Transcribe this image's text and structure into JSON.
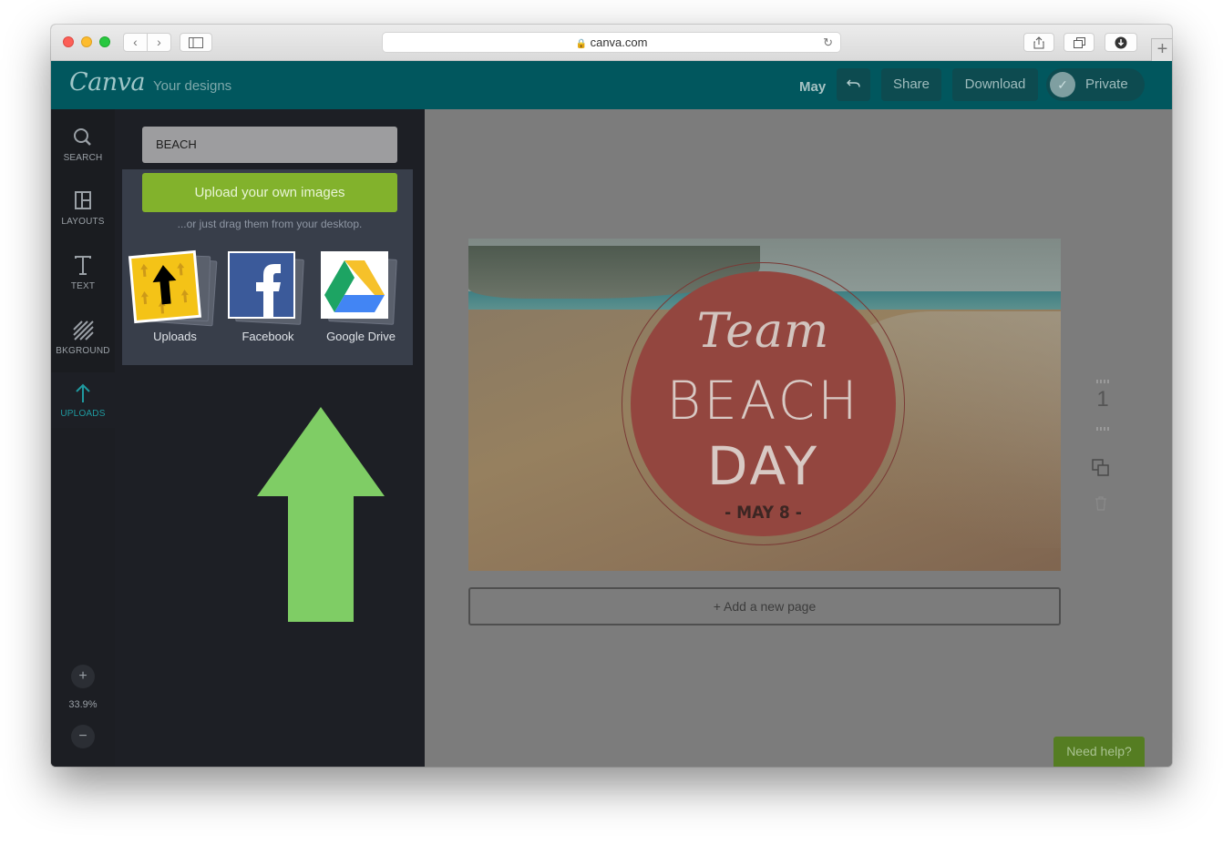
{
  "browser": {
    "url": "canva.com",
    "new_tab_label": "+"
  },
  "header": {
    "logo": "Canva",
    "your_designs": "Your designs",
    "doc_title": "May",
    "share_label": "Share",
    "download_label": "Download",
    "private_label": "Private"
  },
  "rail": {
    "items": [
      {
        "label": "SEARCH",
        "icon": "search-icon"
      },
      {
        "label": "LAYOUTS",
        "icon": "layouts-icon"
      },
      {
        "label": "TEXT",
        "icon": "text-icon"
      },
      {
        "label": "BKGROUND",
        "icon": "background-icon"
      },
      {
        "label": "UPLOADS",
        "icon": "upload-icon"
      }
    ],
    "zoom_in": "+",
    "zoom_level": "33.9%",
    "zoom_out": "−"
  },
  "panel": {
    "search_value": "BEACH",
    "upload_button": "Upload your own images",
    "drag_hint": "...or just drag them from your desktop.",
    "sources": [
      {
        "label": "Uploads",
        "icon": "uploads-folder-icon"
      },
      {
        "label": "Facebook",
        "icon": "facebook-icon"
      },
      {
        "label": "Google Drive",
        "icon": "google-drive-icon"
      }
    ]
  },
  "design": {
    "line1": "Team",
    "line2": "BEACH",
    "line3": "DAY",
    "line4": "- MAY 8 -"
  },
  "workspace": {
    "add_page": "+ Add a new page",
    "page_number": "1",
    "help": "Need help?"
  },
  "colors": {
    "header": "#01575e",
    "upload_green": "#82b22c",
    "arrow_green": "#7fcd65",
    "circle_red": "#93463f"
  }
}
